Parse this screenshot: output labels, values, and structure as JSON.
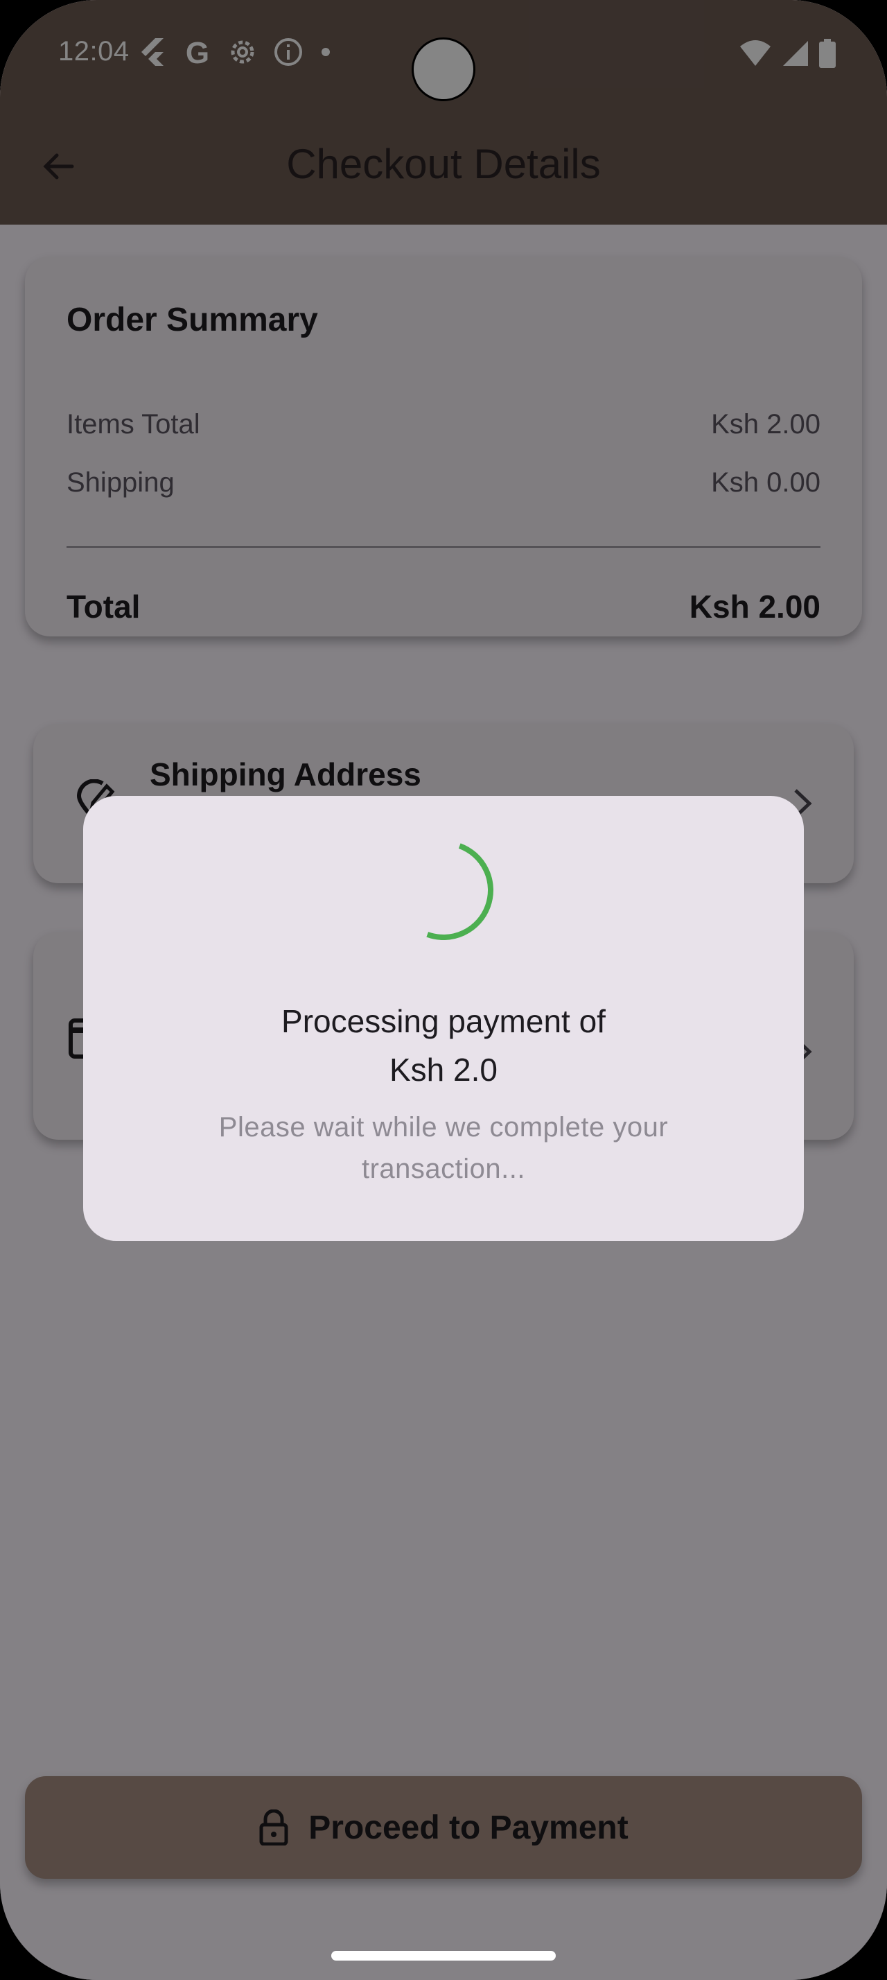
{
  "status_bar": {
    "time": "12:04",
    "icons": [
      "flutter-icon",
      "google-icon",
      "settings-icon",
      "info-icon",
      "dot-icon",
      "wifi-icon",
      "signal-icon",
      "battery-icon"
    ]
  },
  "app_bar": {
    "title": "Checkout Details",
    "back_icon": "arrow-back-icon"
  },
  "order_summary": {
    "title": "Order Summary",
    "items_total_label": "Items Total",
    "items_total_value": "Ksh 2.00",
    "shipping_label": "Shipping",
    "shipping_value": "Ksh 0.00",
    "total_label": "Total",
    "total_value": "Ksh 2.00"
  },
  "shipping_address": {
    "title": "Shipping Address",
    "icon": "edit-location-icon",
    "chevron": "chevron-right-icon"
  },
  "payment_method": {
    "icon": "card-icon",
    "chevron": "chevron-right-icon"
  },
  "proceed_button": {
    "label": "Proceed to Payment",
    "icon": "lock-icon"
  },
  "dialog": {
    "title_line1": "Processing payment of",
    "title_line2": "Ksh 2.0",
    "subtitle": "Please wait while we complete your transaction...",
    "spinner_color": "#4caf50"
  },
  "colors": {
    "app_bar": "#6b5a52",
    "card": "#f6eff6",
    "button": "#a78f82",
    "dialog": "#e8e2ea",
    "scrim": "rgba(0,0,0,0.48)"
  }
}
